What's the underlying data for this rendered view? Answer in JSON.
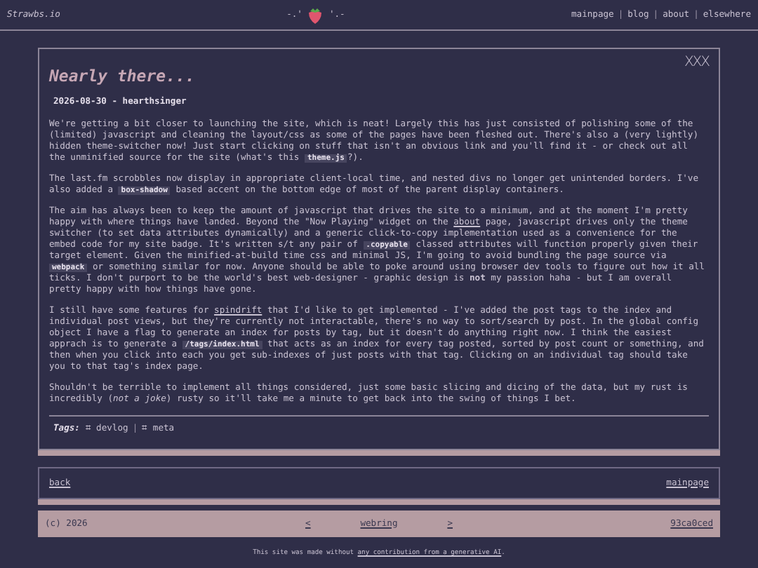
{
  "header": {
    "site_name": "Strawbs.io",
    "logo_left": "-.'",
    "logo_right": "'.-",
    "nav": [
      {
        "label": "mainpage"
      },
      {
        "label": "blog"
      },
      {
        "label": "about"
      },
      {
        "label": "elsewhere"
      }
    ],
    "separator": "|"
  },
  "post": {
    "title": "Nearly there...",
    "mark": "XXX",
    "meta": "2026-08-30 - hearthsinger",
    "paragraphs": [
      [
        {
          "kind": "text",
          "text": "We're getting a bit closer to launching the site, which is neat! Largely this has just consisted of polishing some of the (limited) javascript and cleaning the layout/css as some of the pages have been fleshed out. There's also a (very lightly) hidden theme-switcher now! Just start clicking on stuff that isn't an obvious link and you'll find it - or check out all the unminified source for the site (what's this "
        },
        {
          "kind": "code",
          "text": "theme.js"
        },
        {
          "kind": "text",
          "text": "?)."
        }
      ],
      [
        {
          "kind": "text",
          "text": "The last.fm scrobbles now display in appropriate client-local time, and nested divs no longer get unintended borders. I've also added a "
        },
        {
          "kind": "code",
          "text": "box-shadow"
        },
        {
          "kind": "text",
          "text": " based accent on the bottom edge of most of the parent display containers."
        }
      ],
      [
        {
          "kind": "text",
          "text": "The aim has always been to keep the amount of javascript that drives the site to a minimum, and at the moment I'm pretty happy with where things have landed. Beyond the \"Now Playing\" widget on the "
        },
        {
          "kind": "link",
          "text": "about"
        },
        {
          "kind": "text",
          "text": " page, javascript drives only the theme switcher (to set data attributes dynamically) and a generic click-to-copy implementation used as a convenience for the embed code for my site badge. It's written s/t any pair of "
        },
        {
          "kind": "code",
          "text": ".copyable"
        },
        {
          "kind": "text",
          "text": " classed attributes will function properly given their target element. Given the minified-at-build time css and minimal JS, I'm going to avoid bundling the page source via "
        },
        {
          "kind": "code",
          "text": "webpack"
        },
        {
          "kind": "text",
          "text": " or something similar for now. Anyone should be able to poke around using browser dev tools to figure out how it all ticks. I don't purport to be the world's best web-designer - graphic design is **not** my passion haha - but I am overall pretty happy with how things have gone."
        }
      ],
      [
        {
          "kind": "text",
          "text": "I still have some features for "
        },
        {
          "kind": "link",
          "text": "spindrift"
        },
        {
          "kind": "text",
          "text": " that I'd like to get implemented - I've added the post tags to the index and individual post views, but they're currently not interactable, there's no way to sort/search by post. In the global config object I have a flag to generate an index for posts by tag, but it doesn't do anything right now. I think the easiest apprach is to generate a "
        },
        {
          "kind": "code",
          "text": "/tags/index.html"
        },
        {
          "kind": "text",
          "text": " that acts as an index for every tag posted, sorted by post count or something, and then when you click into each you get sub-indexes of just posts with that tag. Clicking on an individual tag should take you to that tag's index page."
        }
      ],
      [
        {
          "kind": "text",
          "text": "Shouldn't be terrible to implement all things considered, just some basic slicing and dicing of the data, but my rust is incredibly (*not a joke*) rusty so it'll take me a minute to get back into the swing of things I bet."
        }
      ]
    ],
    "tags_label": "Tags:",
    "tags": [
      {
        "label": "⌗ devlog"
      },
      {
        "label": "⌗ meta"
      }
    ],
    "tag_separator": "|"
  },
  "post_nav": {
    "back": "back",
    "mainpage": "mainpage"
  },
  "footer": {
    "copyright": "(c) 2026",
    "prev": "<",
    "webring": "webring",
    "next": ">",
    "commit": "93ca0ced"
  },
  "credit": {
    "text": "This site was made without ",
    "link": "any contribution from a generative AI",
    "end": "."
  }
}
